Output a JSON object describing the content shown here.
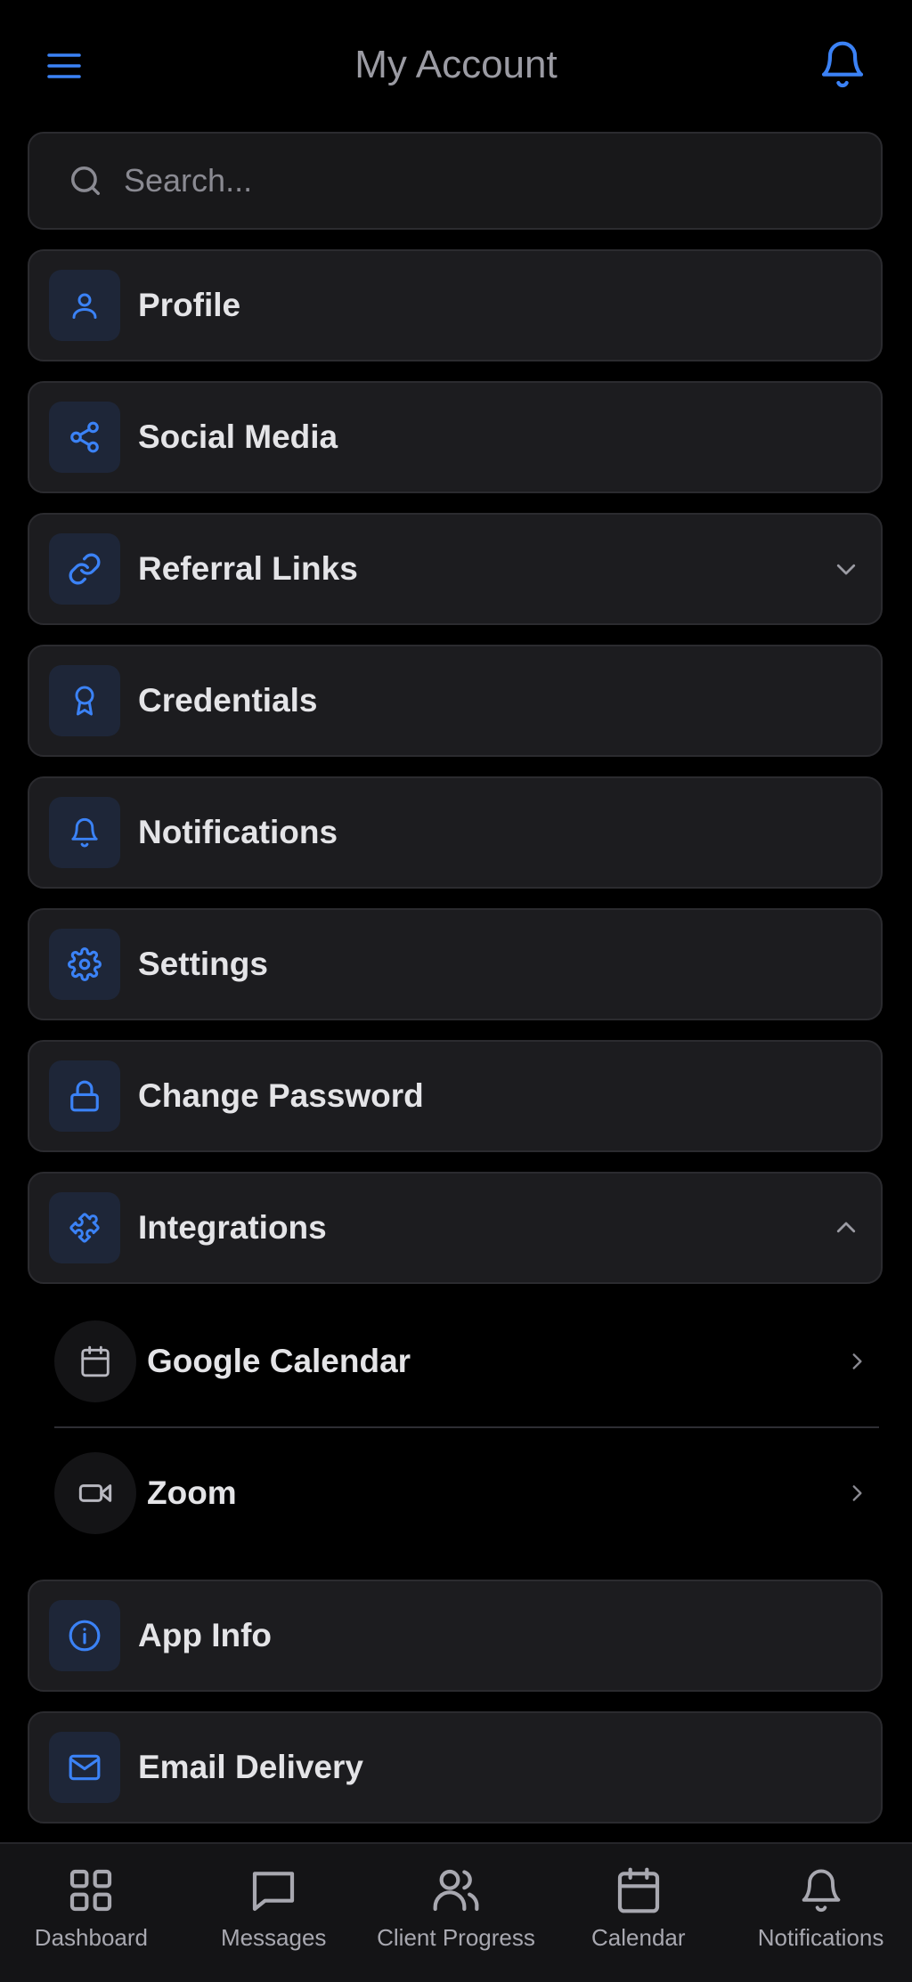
{
  "header": {
    "title": "My Account",
    "menu_icon": "hamburger-icon",
    "bell_icon": "bell-icon"
  },
  "search": {
    "placeholder": "Search...",
    "value": ""
  },
  "menu": {
    "items": [
      {
        "label": "Profile",
        "icon": "user-icon"
      },
      {
        "label": "Social Media",
        "icon": "share-icon"
      },
      {
        "label": "Referral Links",
        "icon": "link-icon",
        "chevron": "down"
      },
      {
        "label": "Credentials",
        "icon": "award-icon"
      },
      {
        "label": "Notifications",
        "icon": "bell-icon"
      },
      {
        "label": "Settings",
        "icon": "gear-icon"
      },
      {
        "label": "Change Password",
        "icon": "lock-icon"
      },
      {
        "label": "Integrations",
        "icon": "puzzle-icon",
        "chevron": "up",
        "children": [
          {
            "label": "Google Calendar",
            "icon": "calendar-icon"
          },
          {
            "label": "Zoom",
            "icon": "video-icon"
          }
        ]
      },
      {
        "label": "App Info",
        "icon": "info-icon"
      },
      {
        "label": "Email Delivery",
        "icon": "mail-icon"
      }
    ]
  },
  "tabbar": {
    "tabs": [
      {
        "label": "Dashboard",
        "icon": "dashboard-icon"
      },
      {
        "label": "Messages",
        "icon": "message-icon"
      },
      {
        "label": "Client Progress",
        "icon": "users-icon"
      },
      {
        "label": "Calendar",
        "icon": "calendar-icon"
      },
      {
        "label": "Notifications",
        "icon": "bell-icon"
      }
    ]
  },
  "colors": {
    "accent": "#3b82f6",
    "background": "#000000",
    "card": "#1c1c1f",
    "icon_tile": "#1e2638",
    "text": "#e4e4e7",
    "muted": "#9b9ba3"
  }
}
